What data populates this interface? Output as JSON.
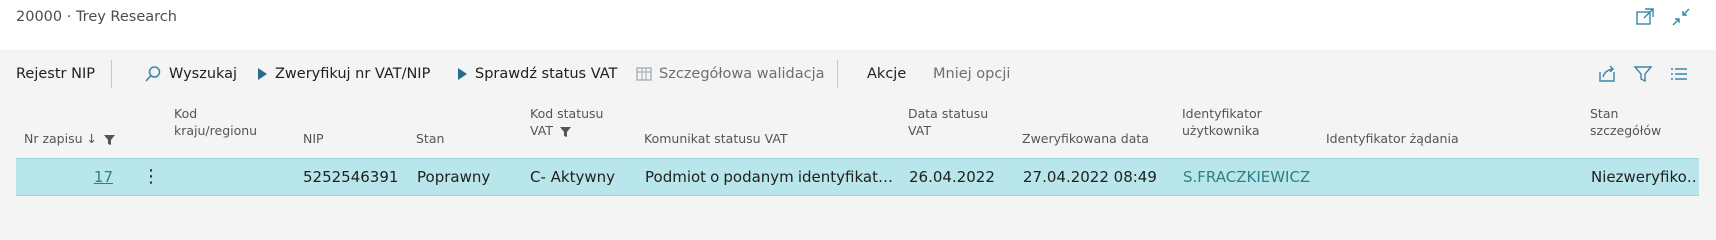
{
  "window": {
    "title": "20000 · Trey Research",
    "icons": [
      "open-new-window-icon",
      "collapse-icon"
    ]
  },
  "actionbar": {
    "page_label": "Rejestr NIP",
    "search_label": "Wyszukaj",
    "verify_label": "Zweryfikuj nr VAT/NIP",
    "check_status_label": "Sprawdź status VAT",
    "detailed_validation_label": "Szczegółowa walidacja",
    "actions_label": "Akcje",
    "less_options_label": "Mniej opcji",
    "right_icons": [
      "share-icon",
      "filter-icon",
      "list-view-icon"
    ]
  },
  "table": {
    "columns": {
      "entry_no": "Nr zapisu",
      "country_1": "Kod",
      "country_2": "kraju/regionu",
      "nip": "NIP",
      "status": "Stan",
      "status_code_1": "Kod statusu",
      "status_code_2": "VAT",
      "status_message": "Komunikat statusu VAT",
      "status_date_1": "Data statusu",
      "status_date_2": "VAT",
      "verified_date": "Zweryfikowana data",
      "user_id_1": "Identyfikator",
      "user_id_2": "użytkownika",
      "request_id": "Identyfikator żądania",
      "details_status_1": "Stan",
      "details_status_2": "szczegółów"
    },
    "rows": [
      {
        "entry_no": "17",
        "nip": "5252546391",
        "status": "Poprawny",
        "status_code": "C- Aktywny",
        "message_words": [
          "Podmiot",
          "o",
          "podanym",
          "identyfikat…"
        ],
        "status_date": "26.04.2022",
        "verified_date": "27.04.2022 08:49",
        "user_id": "S.FRACZKIEWICZ",
        "details_status": "Niezweryfiko…"
      }
    ]
  },
  "colors": {
    "accent": "#2f7f84",
    "row_highlight": "#b8e6ea",
    "icon_blue": "#3a86a8"
  }
}
